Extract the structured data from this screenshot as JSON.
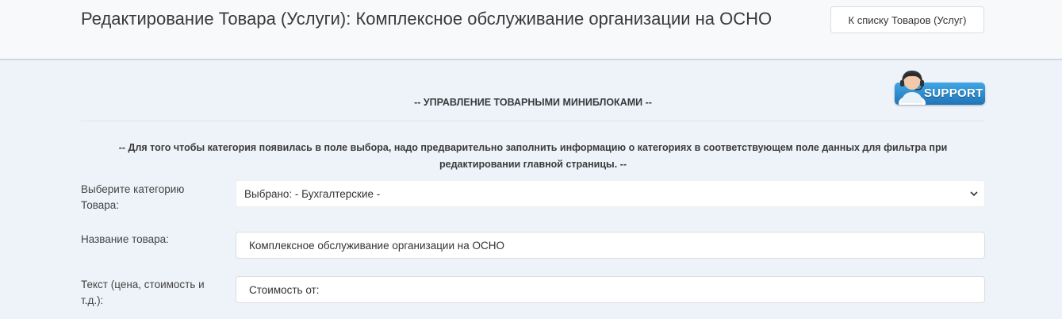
{
  "header": {
    "title": "Редактирование Товара (Услуги): Комплексное обслуживание организации на ОСНО",
    "back_button_label": "К списку Товаров (Услуг)"
  },
  "support": {
    "label": "SUPPORT",
    "icon": "support-operator-icon",
    "color": "#2b8ad0"
  },
  "section": {
    "title": "-- УПРАВЛЕНИЕ ТОВАРНЫМИ МИНИБЛОКАМИ --",
    "notice": "-- Для того чтобы категория появилась в поле выбора, надо предварительно заполнить информацию о категориях в соответствующем поле данных для фильтра при редактировании главной страницы. --"
  },
  "form": {
    "category": {
      "label": "Выберите категорию Товара:",
      "selected": "Выбрано: - Бухгалтерские -"
    },
    "name": {
      "label": "Название товара:",
      "value": "Комплексное обслуживание организации на ОСНО"
    },
    "text": {
      "label": "Текст (цена, стоимость и т.д.):",
      "value": "Стоимость от:"
    }
  }
}
